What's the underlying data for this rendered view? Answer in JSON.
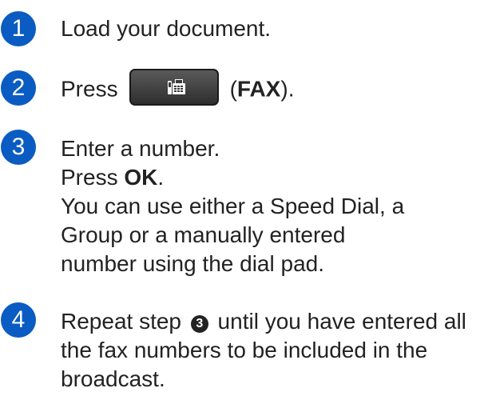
{
  "steps": [
    {
      "number": "1",
      "text": "Load your document."
    },
    {
      "number": "2",
      "prefix": "Press",
      "key_label_open": "(",
      "key_label": "FAX",
      "key_label_close": ")."
    },
    {
      "number": "3",
      "line1": "Enter a number.",
      "line2_prefix": "Press ",
      "line2_bold": "OK",
      "line2_suffix": ".",
      "line3": "You can use either a Speed Dial, a Group or a manually entered number using the dial pad."
    },
    {
      "number": "4",
      "before_ref": "Repeat step ",
      "ref": "3",
      "after_ref": " until you have entered all the fax numbers to be included in the broadcast."
    }
  ],
  "colors": {
    "badge": "#0a5cc2",
    "text": "#222222",
    "key": "#3a3a3a"
  },
  "icons": {
    "fax_key": "fax-icon"
  }
}
